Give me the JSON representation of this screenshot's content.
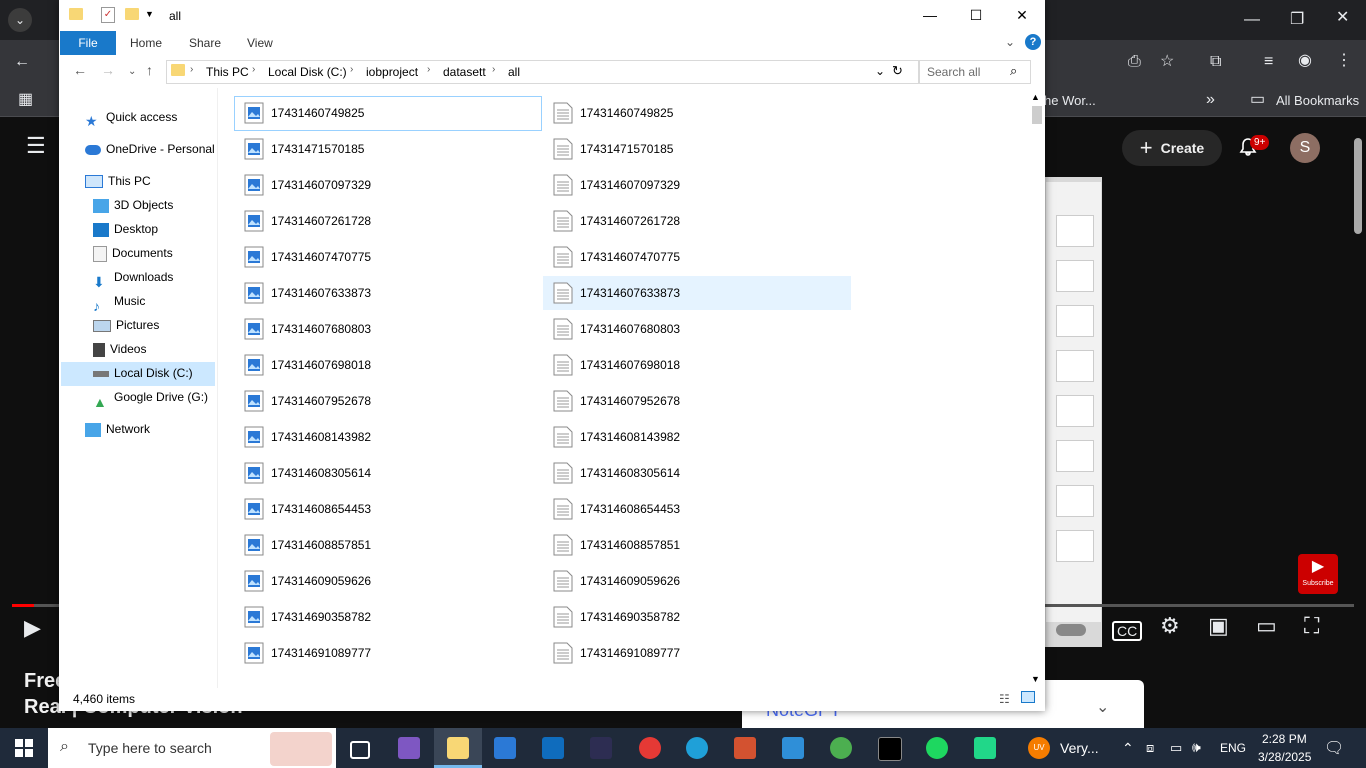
{
  "explorer": {
    "title": "all",
    "ribbon_tabs": [
      "File",
      "Home",
      "Share",
      "View"
    ],
    "breadcrumb": [
      "This PC",
      "Local Disk (C:)",
      "iobproject",
      "datasett",
      "all"
    ],
    "search_placeholder": "Search all",
    "nav": {
      "quick_access": "Quick access",
      "onedrive": "OneDrive - Personal",
      "this_pc": "This PC",
      "objects3d": "3D Objects",
      "desktop": "Desktop",
      "documents": "Documents",
      "downloads": "Downloads",
      "music": "Music",
      "pictures": "Pictures",
      "videos": "Videos",
      "local_disk": "Local Disk (C:)",
      "google_drive": "Google Drive (G:)",
      "network": "Network"
    },
    "files": [
      "17431460749825",
      "17431471570185",
      "174314607097329",
      "174314607261728",
      "174314607470775",
      "174314607633873",
      "174314607680803",
      "174314607698018",
      "174314607952678",
      "174314608143982",
      "174314608305614",
      "174314608654453",
      "174314608857851",
      "174314609059626",
      "174314690358782",
      "174314691089777"
    ],
    "status": "4,460 items"
  },
  "browser": {
    "bookmark_partial": "he Wor...",
    "all_bookmarks": "All Bookmarks",
    "create": "Create",
    "notif_count": "9+",
    "avatar_letter": "S",
    "video_title_line1": "Free",
    "video_title_line2": "Real | Computer Vision",
    "notegpt": "NoteGPT",
    "subscribe": "Subscribe"
  },
  "taskbar": {
    "search_placeholder": "Type here to search",
    "weather": "Very...",
    "lang": "ENG",
    "time": "2:28 PM",
    "date": "3/28/2025"
  }
}
